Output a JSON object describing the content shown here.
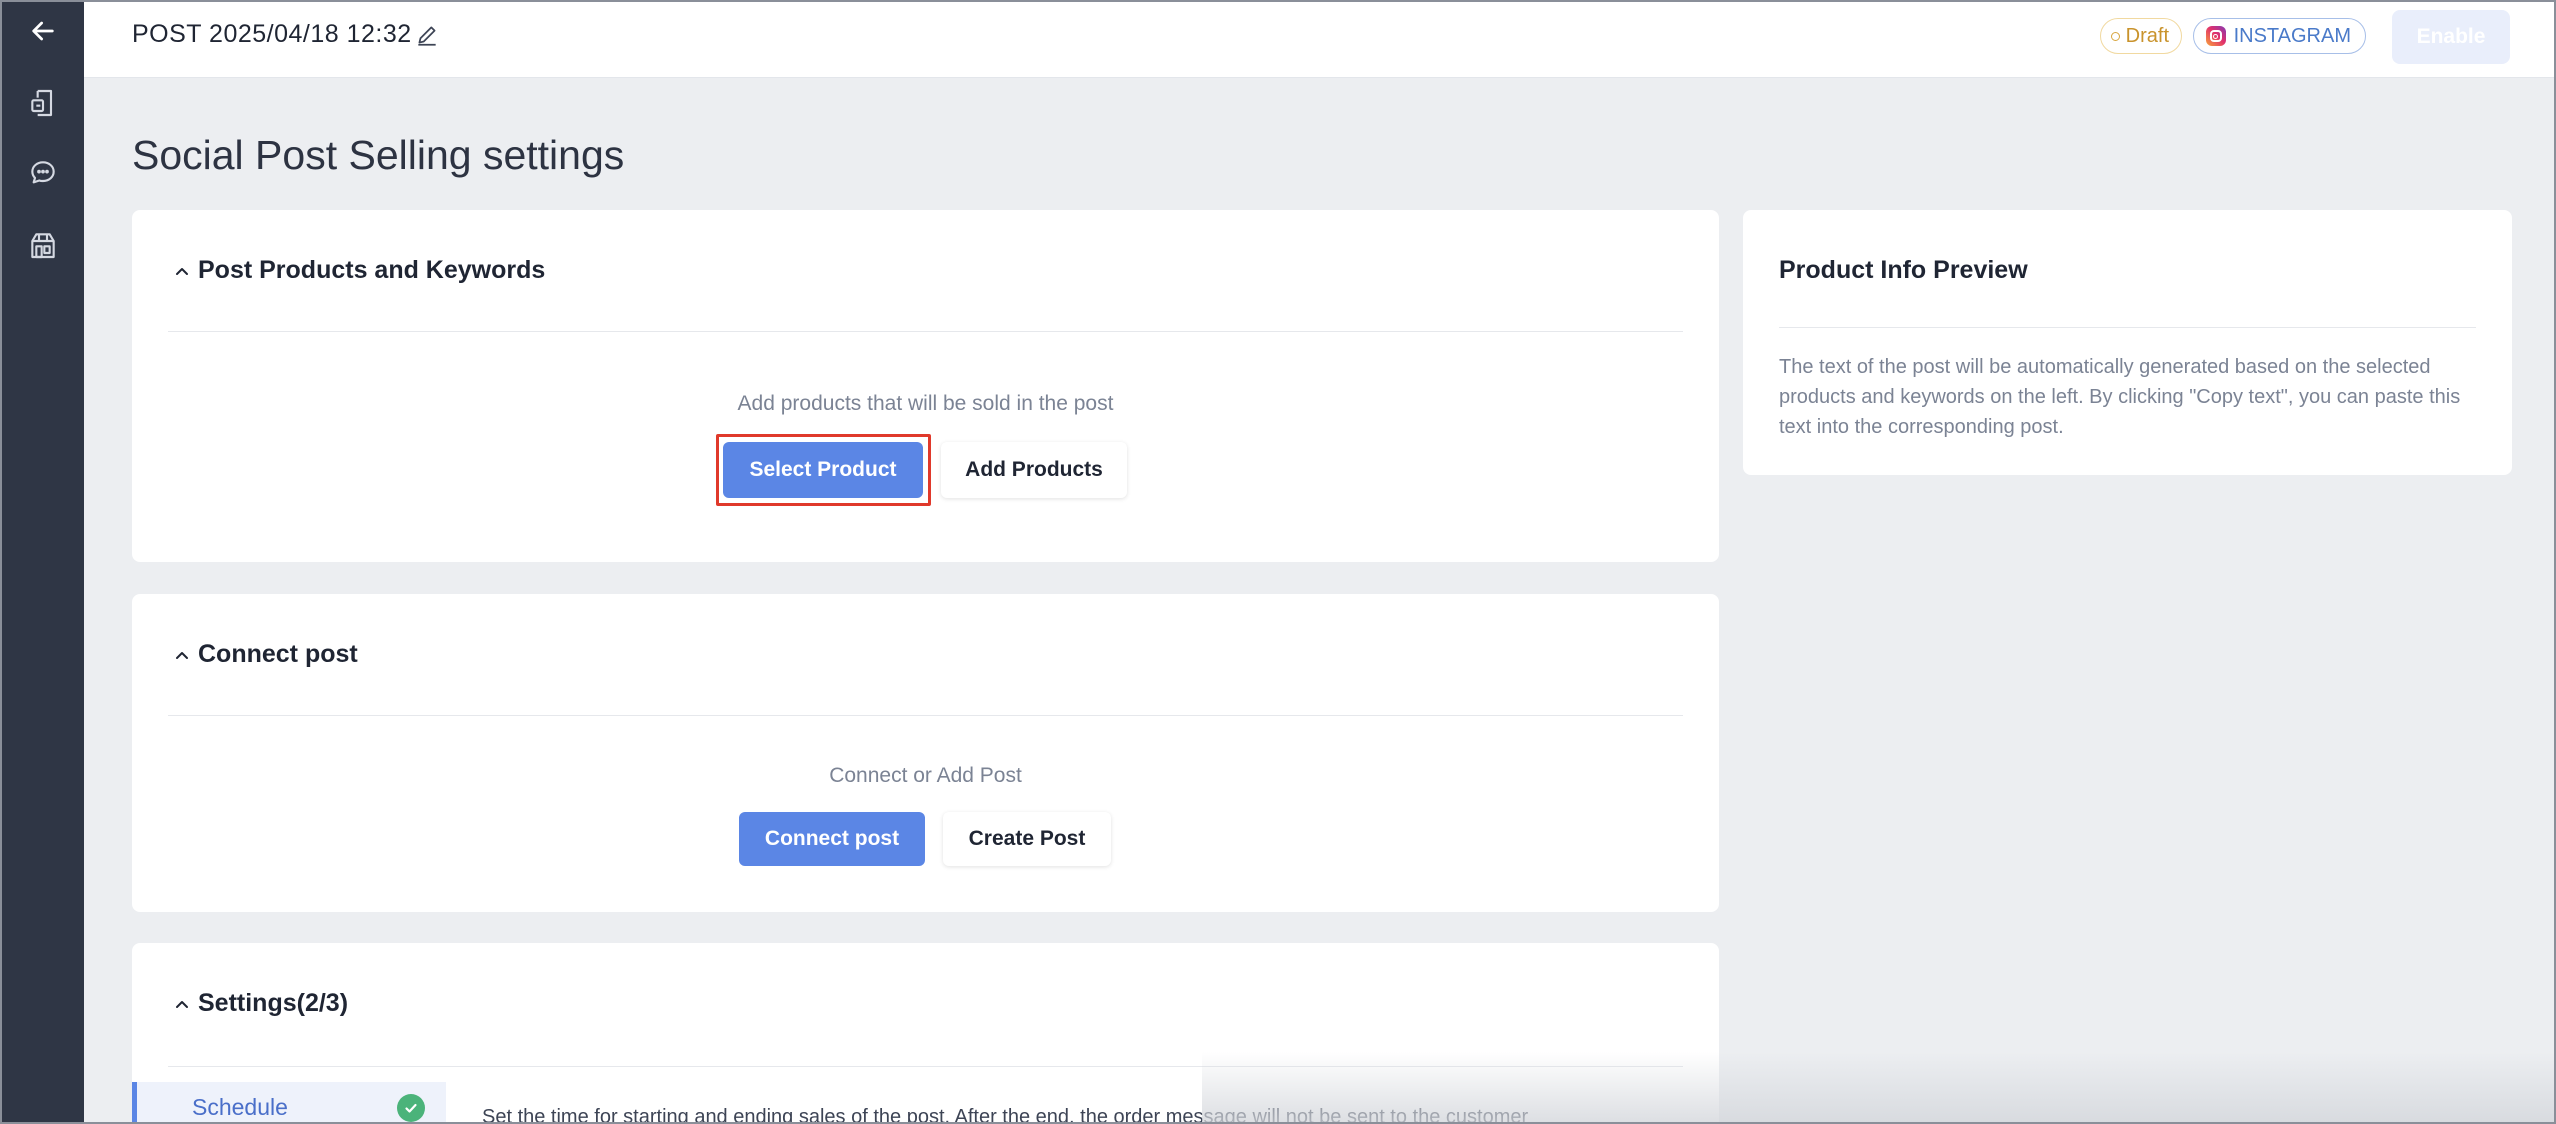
{
  "header": {
    "post_title": "POST 2025/04/18 12:32",
    "status_badge": "Draft",
    "platform_badge": "INSTAGRAM",
    "enable_label": "Enable"
  },
  "page": {
    "title": "Social Post Selling settings"
  },
  "products_card": {
    "title": "Post Products and Keywords",
    "hint": "Add products that will be sold in the post",
    "select_label": "Select Product",
    "add_label": "Add Products"
  },
  "connect_card": {
    "title": "Connect post",
    "hint": "Connect or Add Post",
    "connect_label": "Connect post",
    "create_label": "Create Post"
  },
  "settings_card": {
    "title": "Settings(2/3)",
    "tab_schedule": "Schedule",
    "schedule_desc": "Set the time for starting and ending sales of the post. After the end, the order message will not be sent to the customer"
  },
  "preview_card": {
    "title": "Product Info Preview",
    "text": "The text of the post will be automatically generated based on the selected products and keywords on the left. By clicking \"Copy text\", you can paste this text into the corresponding post."
  },
  "icons": {
    "sidebar": [
      "back-arrow-icon",
      "post-document-icon",
      "chat-bubble-icon",
      "store-icon"
    ],
    "edit": "pencil-icon",
    "collapse": "chevron-up-icon",
    "check": "check-circle-icon"
  },
  "colors": {
    "sidebar": "#2f3645",
    "primary": "#5b86e5",
    "draft": "#c9932c",
    "instagram": "#4a7ac9",
    "highlight": "#e0392b",
    "success": "#4bb37a"
  }
}
